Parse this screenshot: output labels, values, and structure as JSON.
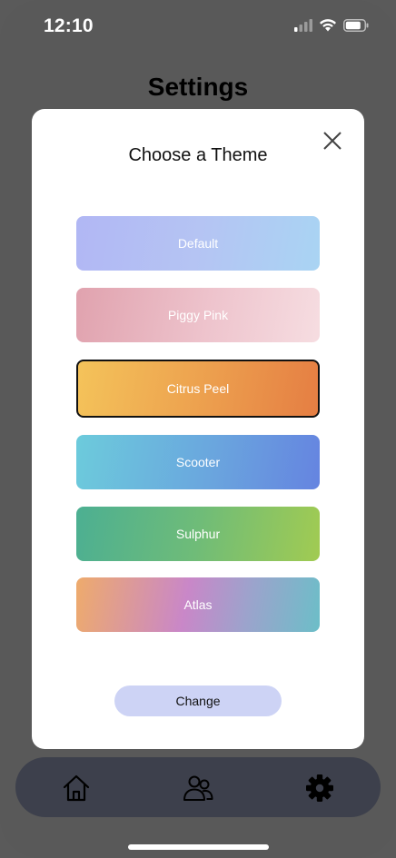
{
  "status_bar": {
    "time": "12:10",
    "icons": [
      "cellular-signal-icon",
      "wifi-icon",
      "battery-icon"
    ]
  },
  "page": {
    "title": "Settings"
  },
  "modal": {
    "title": "Choose a Theme",
    "close_icon": "close-icon",
    "themes": [
      {
        "label": "Default",
        "selected": false,
        "colors": [
          "#b1b7f4",
          "#a9d4f3"
        ]
      },
      {
        "label": "Piggy Pink",
        "selected": false,
        "colors": [
          "#e0a2ae",
          "#f6dde1"
        ]
      },
      {
        "label": "Citrus Peel",
        "selected": true,
        "colors": [
          "#f4c35a",
          "#e57e43"
        ]
      },
      {
        "label": "Scooter",
        "selected": false,
        "colors": [
          "#6ccbdc",
          "#6584e0"
        ]
      },
      {
        "label": "Sulphur",
        "selected": false,
        "colors": [
          "#4caf92",
          "#a1cb52"
        ]
      },
      {
        "label": "Atlas",
        "selected": false,
        "colors": [
          "#eeab6c",
          "#c987c8",
          "#6cbec8"
        ]
      }
    ],
    "change_label": "Change"
  },
  "tab_bar": {
    "items": [
      {
        "name": "home",
        "icon": "home-icon"
      },
      {
        "name": "people",
        "icon": "people-icon"
      },
      {
        "name": "settings",
        "icon": "gear-icon"
      }
    ]
  },
  "colors": {
    "overlay_background": "#595959",
    "modal_background": "#ffffff",
    "change_button": "#cdd3f5",
    "tab_bar": "#3d404c"
  }
}
